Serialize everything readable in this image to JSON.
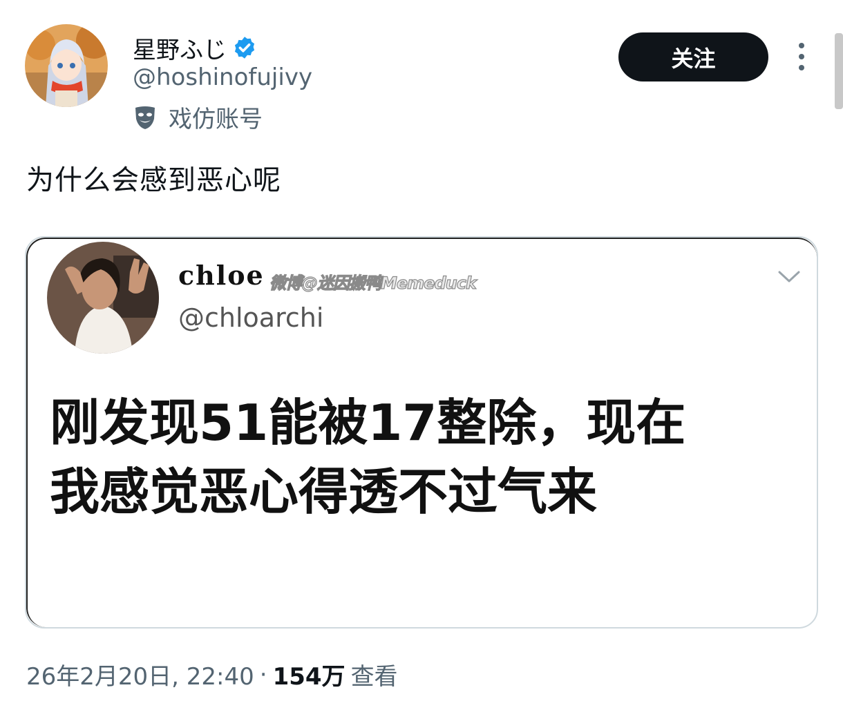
{
  "author": {
    "display_name": "星野ふじ",
    "handle": "@hoshinofujivy",
    "parody_label": "戏仿账号",
    "verified": true
  },
  "actions": {
    "follow_label": "关注"
  },
  "tweet": {
    "text": "为什么会感到恶心呢"
  },
  "embedded": {
    "name": "chloe",
    "watermark": "微博@迷因搬鸭Memeduck",
    "handle": "@chloarchi",
    "body_line1": "刚发现51能被17整除，现在",
    "body_line2": "我感觉恶心得透不过气来"
  },
  "meta": {
    "timestamp": "26年2月20日, 22:40",
    "separator": "·",
    "views_count": "154万",
    "views_label": "查看"
  },
  "colors": {
    "verified_blue": "#1d9bf0",
    "secondary_text": "#536471",
    "follow_bg": "#0f1419"
  },
  "icons": [
    "verified-badge-icon",
    "parody-mask-icon",
    "more-options-icon",
    "chevron-down-icon"
  ]
}
